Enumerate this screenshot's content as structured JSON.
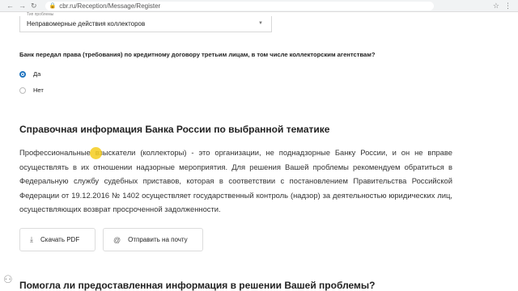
{
  "browser": {
    "url": "cbr.ru/Reception/Message/Register",
    "back_icon": "←",
    "forward_icon": "→",
    "reload_icon": "↻",
    "lock_icon": "🔒",
    "star_icon": "☆",
    "menu_icon": "⋮"
  },
  "form": {
    "field_label": "Тип проблемы",
    "selected_value": "Неправомерные действия коллекторов",
    "select_arrow": "▼",
    "question": "Банк передал права (требования) по кредитному договору третьим лицам, в том числе коллекторским агентствам?",
    "options": [
      {
        "label": "Да",
        "checked": true
      },
      {
        "label": "Нет",
        "checked": false
      }
    ]
  },
  "info": {
    "title": "Справочная информация Банка России по выбранной тематике",
    "text": "Профессиональные взыскатели (коллекторы) - это организации, не поднадзорные Банку России, и он не вправе осуществлять в их отношении надзорные мероприятия. Для решения Вашей проблемы рекомендуем обратиться в Федеральную службу судебных приставов, которая в соответствии с постановлением Правительства Российской Федерации от 19.12.2016 № 1402 осуществляет государственный контроль (надзор) за деятельностью юридических лиц, осуществляющих возврат просроченной задолженности."
  },
  "actions": {
    "pdf_label": "Скачать PDF",
    "pdf_icon": "⤓",
    "mail_label": "Отправить на почту",
    "mail_icon": "@"
  },
  "feedback": {
    "title": "Помогла ли предоставленная информация в решении Вашей проблемы?"
  },
  "corner": {
    "icon": "⚇"
  }
}
